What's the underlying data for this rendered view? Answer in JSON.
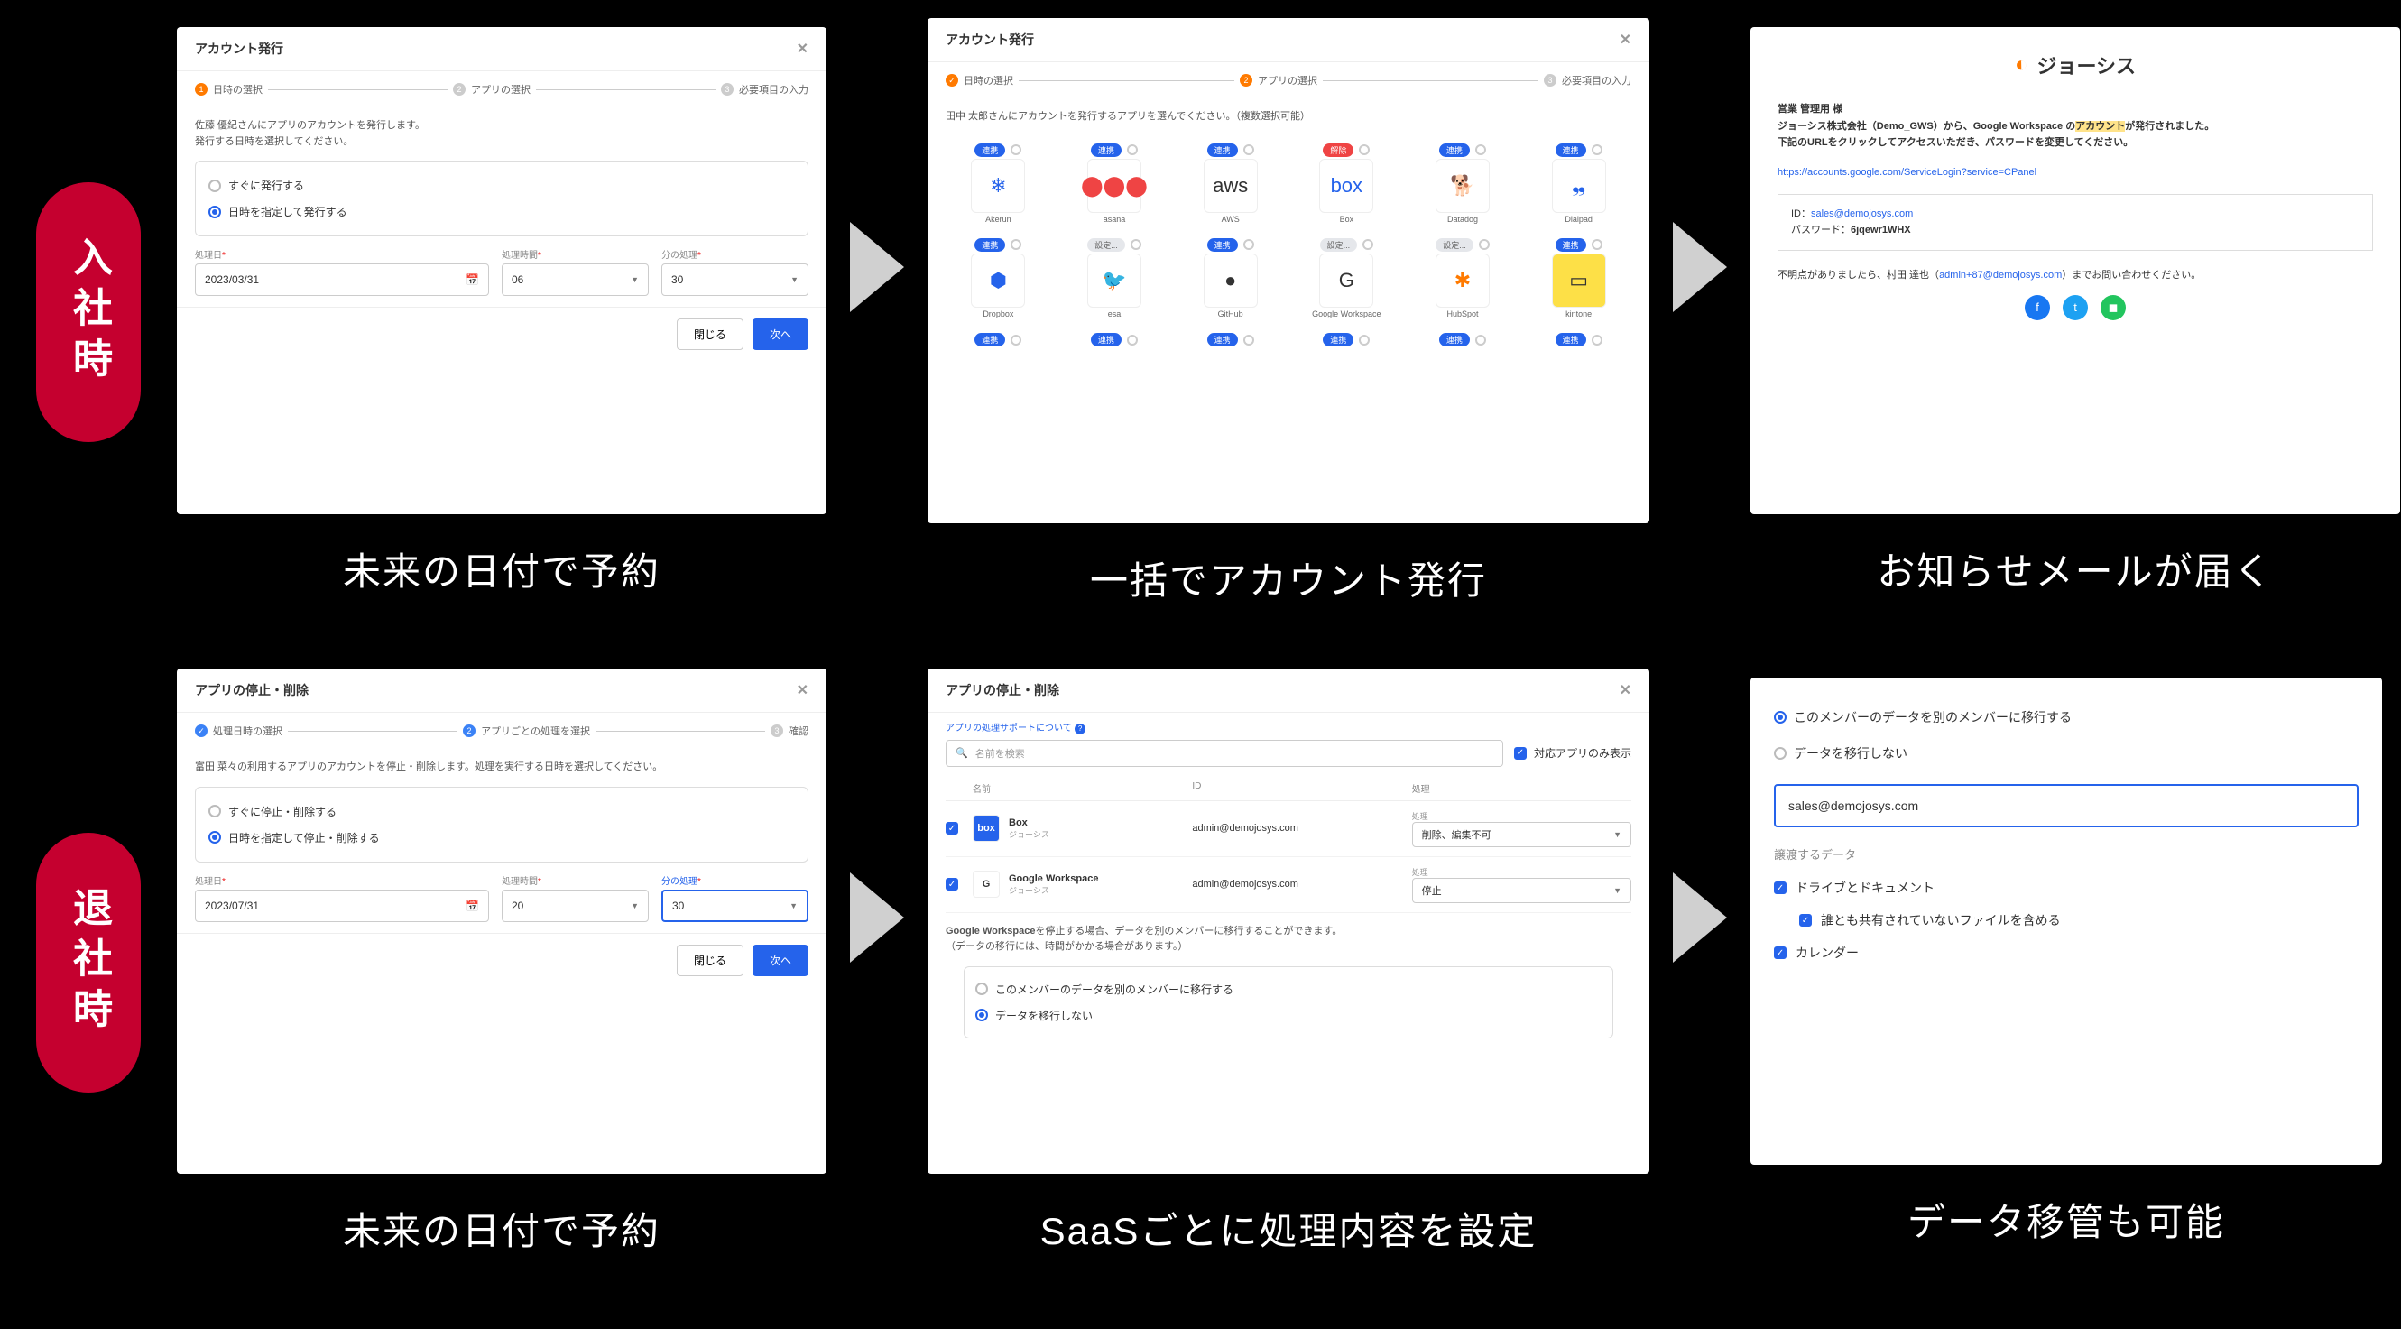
{
  "row1": {
    "label": "入社時",
    "captions": [
      "未来の日付で予約",
      "一括でアカウント発行",
      "お知らせメールが届く"
    ],
    "card1": {
      "title": "アカウント発行",
      "steps": [
        "日時の選択",
        "アプリの選択",
        "必要項目の入力"
      ],
      "active_step": 0,
      "hint1": "佐藤 優紀さんにアプリのアカウントを発行します。",
      "hint2": "発行する日時を選択してください。",
      "options": [
        {
          "label": "すぐに発行する",
          "selected": false
        },
        {
          "label": "日時を指定して発行する",
          "selected": true
        }
      ],
      "fields": {
        "date_label": "処理日",
        "date_value": "2023/03/31",
        "hm_label": "処理時間",
        "hm_value": "06",
        "min_label": "分の処理",
        "min_value": "30"
      },
      "footer": {
        "close": "閉じる",
        "next": "次へ"
      }
    },
    "card2": {
      "title": "アカウント発行",
      "steps": [
        "日時の選択",
        "アプリの選択",
        "必要項目の入力"
      ],
      "active_step": 1,
      "hint": "田中 太郎さんにアカウントを発行するアプリを選んでください。（複数選択可能）",
      "badge_link": "連携",
      "badge_unlink": "解除",
      "badge_cfg": "設定...",
      "apps": [
        {
          "name": "Akerun",
          "badge": "連携",
          "glyph": "❄",
          "cls": "ic-blue"
        },
        {
          "name": "asana",
          "badge": "連携",
          "glyph": "⬤⬤⬤",
          "cls": "ic-red"
        },
        {
          "name": "AWS",
          "badge": "連携",
          "glyph": "aws",
          "cls": ""
        },
        {
          "name": "Box",
          "badge": "解除",
          "glyph": "box",
          "cls": "ic-blue"
        },
        {
          "name": "Datadog",
          "badge": "連携",
          "glyph": "🐕",
          "cls": "ic-purple"
        },
        {
          "name": "Dialpad",
          "badge": "連携",
          "glyph": "❠",
          "cls": "ic-blue"
        },
        {
          "name": "Dropbox",
          "badge": "連携",
          "glyph": "⬢",
          "cls": "ic-blue"
        },
        {
          "name": "esa",
          "badge": "設定...",
          "glyph": "🐦",
          "cls": "ic-green"
        },
        {
          "name": "GitHub",
          "badge": "連携",
          "glyph": "●",
          "cls": ""
        },
        {
          "name": "Google Workspace",
          "badge": "設定...",
          "glyph": "G",
          "cls": ""
        },
        {
          "name": "HubSpot",
          "badge": "設定...",
          "glyph": "✱",
          "cls": "ic-orange"
        },
        {
          "name": "kintone",
          "badge": "連携",
          "glyph": "▭",
          "cls": "ic-yellow"
        }
      ]
    },
    "card3": {
      "brand": "ジョーシス",
      "line1": "営業 管理用 様",
      "line2_a": "ジョーシス株式会社（Demo_GWS）から、Google Workspace の",
      "line2_hl": "アカウント",
      "line2_b": "が発行されました。",
      "line3": "下記のURLをクリックしてアクセスいただき、パスワードを変更してください。",
      "url": "https://accounts.google.com/ServiceLogin?service=CPanel",
      "id_label": "ID：",
      "id_value": "sales@demojosys.com",
      "pw_label": "パスワード：",
      "pw_value": "6jqewr1WHX",
      "footer": "不明点がありましたら、村田 達也（",
      "footer_mail": "admin+87@demojosys.com",
      "footer2": "）までお問い合わせください。"
    }
  },
  "row2": {
    "label": "退社時",
    "captions": [
      "未来の日付で予約",
      "SaaSごとに処理内容を設定",
      "データ移管も可能"
    ],
    "card1": {
      "title": "アプリの停止・削除",
      "steps": [
        "処理日時の選択",
        "アプリごとの処理を選択",
        "確認"
      ],
      "active_step": 1,
      "hint": "富田 菜々の利用するアプリのアカウントを停止・削除します。処理を実行する日時を選択してください。",
      "options": [
        {
          "label": "すぐに停止・削除する",
          "selected": false
        },
        {
          "label": "日時を指定して停止・削除する",
          "selected": true
        }
      ],
      "fields": {
        "date_label": "処理日",
        "date_value": "2023/07/31",
        "hm_label": "処理時間",
        "hm_value": "20",
        "min_label": "分の処理",
        "min_value": "30"
      },
      "footer": {
        "close": "閉じる",
        "next": "次へ"
      }
    },
    "card2": {
      "title": "アプリの停止・削除",
      "help": "アプリの処理サポートについて",
      "search_ph": "名前を検索",
      "filter": "対応アプリのみ表示",
      "thead": {
        "name": "名前",
        "id": "ID",
        "proc": "処理"
      },
      "rows": [
        {
          "app": "Box",
          "sub": "ジョーシス",
          "icon_bg": "#2563eb",
          "icon_txt": "box",
          "id": "admin@demojosys.com",
          "proc_label": "処理",
          "action": "削除、編集不可"
        },
        {
          "app": "Google Workspace",
          "sub": "ジョーシス",
          "icon_bg": "#fff",
          "icon_txt": "G",
          "id": "admin@demojosys.com",
          "proc_label": "処理",
          "action": "停止"
        }
      ],
      "note_bold": "Google Workspace",
      "note1": "を停止する場合、データを別のメンバーに移行することができます。",
      "note2": "（データの移行には、時間がかかる場合があります。）",
      "opts": [
        {
          "label": "このメンバーのデータを別のメンバーに移行する",
          "selected": false
        },
        {
          "label": "データを移行しない",
          "selected": true
        }
      ]
    },
    "card3": {
      "opts": [
        {
          "label": "このメンバーのデータを別のメンバーに移行する",
          "selected": true
        },
        {
          "label": "データを移行しない",
          "selected": false
        }
      ],
      "input": "sales@demojosys.com",
      "section": "譲渡するデータ",
      "checks": [
        {
          "label": "ドライブとドキュメント",
          "checked": true,
          "indent": false
        },
        {
          "label": "誰とも共有されていないファイルを含める",
          "checked": true,
          "indent": true
        },
        {
          "label": "カレンダー",
          "checked": true,
          "indent": false
        }
      ]
    }
  }
}
